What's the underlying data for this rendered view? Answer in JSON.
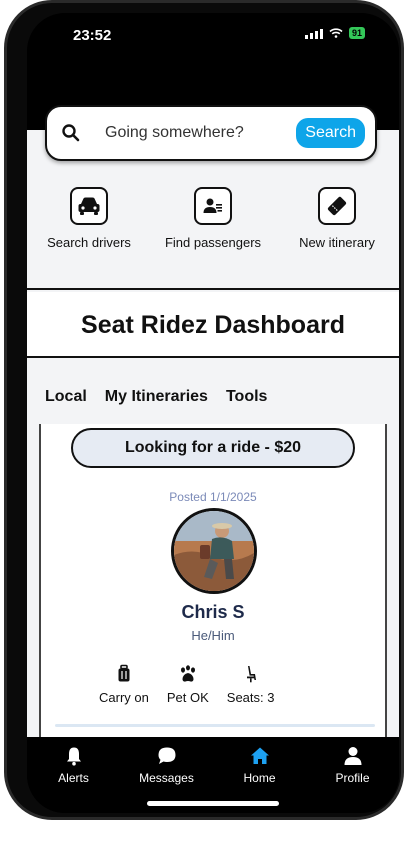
{
  "status": {
    "time": "23:52",
    "battery": "91"
  },
  "search": {
    "placeholder": "Going somewhere?",
    "button_label": "Search"
  },
  "actions": [
    {
      "label": "Search drivers",
      "icon": "car-icon"
    },
    {
      "label": "Find passengers",
      "icon": "passengers-icon"
    },
    {
      "label": "New itinerary",
      "icon": "ticket-icon"
    }
  ],
  "dashboard": {
    "title": "Seat Ridez Dashboard"
  },
  "tabs": [
    {
      "label": "Local"
    },
    {
      "label": "My Itineraries"
    },
    {
      "label": "Tools"
    }
  ],
  "ride_card": {
    "headline": "Looking for a ride - $20",
    "posted": "Posted 1/1/2025",
    "driver_name": "Chris S",
    "pronouns": "He/Him",
    "features": [
      {
        "label": "Carry on",
        "icon": "luggage-icon"
      },
      {
        "label": "Pet OK",
        "icon": "paw-icon"
      },
      {
        "label": "Seats: 3",
        "icon": "seat-icon"
      }
    ]
  },
  "bottom_nav": [
    {
      "label": "Alerts",
      "icon": "bell-icon"
    },
    {
      "label": "Messages",
      "icon": "chat-icon"
    },
    {
      "label": "Home",
      "icon": "home-icon",
      "active": true
    },
    {
      "label": "Profile",
      "icon": "person-icon"
    }
  ],
  "colors": {
    "accent": "#0ea5e9",
    "home_active": "#1da1f2",
    "battery": "#34c759"
  }
}
